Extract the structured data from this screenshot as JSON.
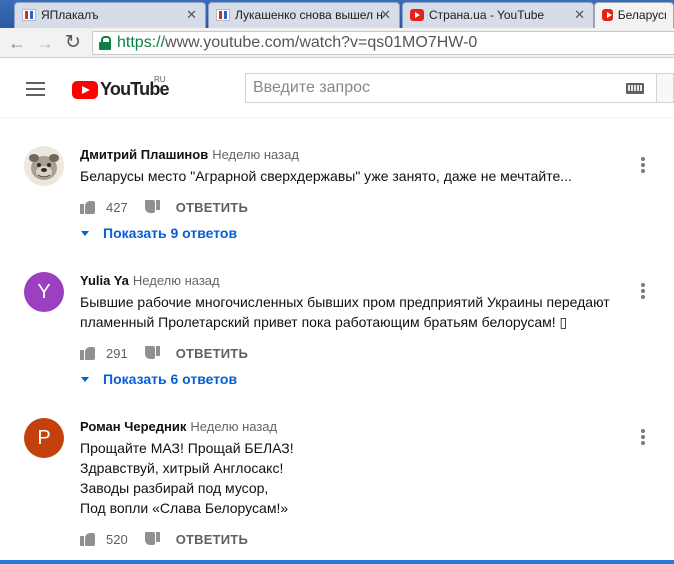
{
  "browser": {
    "tabs": [
      {
        "title": "ЯПлакалъ",
        "favicon": "yaplakal-icon"
      },
      {
        "title": "Лукашенко снова вышел н",
        "favicon": "yaplakal-icon"
      },
      {
        "title": "Страна.ua - YouTube",
        "favicon": "youtube-icon"
      },
      {
        "title": "Беларусь б",
        "favicon": "youtube-icon"
      }
    ],
    "url_scheme": "https://",
    "url_rest": "www.youtube.com/watch?v=qs01MO7HW-0"
  },
  "header": {
    "logo_text": "YouTube",
    "region": "RU",
    "search_placeholder": "Введите запрос"
  },
  "comments": [
    {
      "author": "Дмитрий Плашинов",
      "time": "Неделю назад",
      "lines": [
        "Беларусы место \"Аграрной сверхдержавы\" уже занято, даже не мечтайте..."
      ],
      "likes": "427",
      "reply_label": "ОТВЕТИТЬ",
      "replies_label": "Показать 9 ответов",
      "avatar_letter": "",
      "avatar_color": "#d9d3c4"
    },
    {
      "author": "Yulia Ya",
      "time": "Неделю назад",
      "lines": [
        "Бывшие рабочие многочисленных бывших пром предприятий Украины передают",
        "пламенный Пролетарский привет пока работающим братьям белорусам! ▯"
      ],
      "likes": "291",
      "reply_label": "ОТВЕТИТЬ",
      "replies_label": "Показать 6 ответов",
      "avatar_letter": "Y",
      "avatar_color": "#9c3fc1"
    },
    {
      "author": "Роман Чередник",
      "time": "Неделю назад",
      "lines": [
        "Прощайте МАЗ! Прощай БЕЛАЗ!",
        "Здравствуй, хитрый Англосакс!",
        "Заводы разбирай под мусор,",
        "Под вопли «Слава Белорусам!»"
      ],
      "likes": "520",
      "reply_label": "ОТВЕТИТЬ",
      "replies_label": "",
      "avatar_letter": "P",
      "avatar_color": "#c2410c"
    }
  ],
  "colors": {
    "link_blue": "#065fd4",
    "youtube_red": "#ff0000"
  }
}
